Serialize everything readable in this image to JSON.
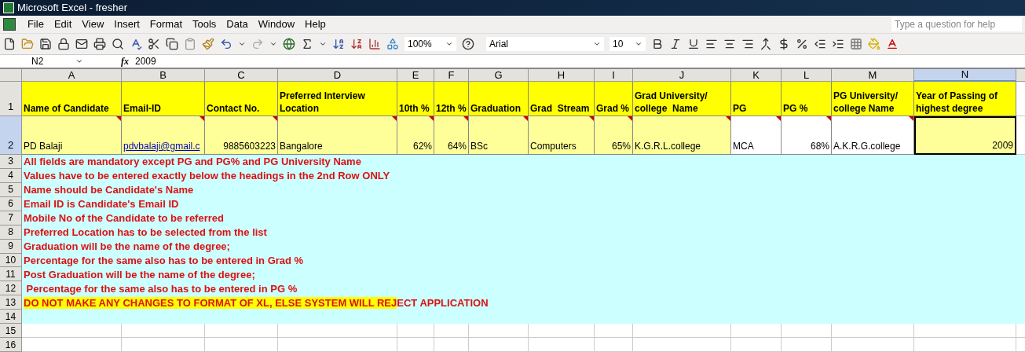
{
  "window": {
    "title": "Microsoft Excel - fresher"
  },
  "menu": [
    "File",
    "Edit",
    "View",
    "Insert",
    "Format",
    "Tools",
    "Data",
    "Window",
    "Help"
  ],
  "help_box": {
    "placeholder": "Type a question for help"
  },
  "toolbar": {
    "zoom": "100%",
    "font": "Arial",
    "font_size": "10"
  },
  "formula_bar": {
    "name_box": "N2",
    "function_label": "fx",
    "formula": "2009"
  },
  "columns": [
    {
      "letter": "A",
      "selected": false
    },
    {
      "letter": "B",
      "selected": false
    },
    {
      "letter": "C",
      "selected": false
    },
    {
      "letter": "D",
      "selected": false
    },
    {
      "letter": "E",
      "selected": false
    },
    {
      "letter": "F",
      "selected": false
    },
    {
      "letter": "G",
      "selected": false
    },
    {
      "letter": "H",
      "selected": false
    },
    {
      "letter": "I",
      "selected": false
    },
    {
      "letter": "J",
      "selected": false
    },
    {
      "letter": "K",
      "selected": false
    },
    {
      "letter": "L",
      "selected": false
    },
    {
      "letter": "M",
      "selected": false
    },
    {
      "letter": "N",
      "selected": true
    }
  ],
  "header_row": {
    "number": "1",
    "selected": false,
    "cells": [
      "Name of Candidate",
      "Email-ID",
      "Contact No.",
      "Preferred Interview Location",
      "10th %",
      "12th %",
      "Graduation",
      "Grad  Stream",
      "Grad %",
      "Grad University/ college  Name",
      "PG",
      "PG %",
      "PG University/ college Name",
      "Year of Passing of highest degree"
    ]
  },
  "data_row": {
    "number": "2",
    "selected": true,
    "cells": [
      {
        "kind": "text",
        "text": "PD Balaji",
        "highlighted": true,
        "comment": true,
        "selected": false
      },
      {
        "kind": "link",
        "text": "pdvbalaji@gmail.c",
        "highlighted": true,
        "comment": true,
        "selected": false
      },
      {
        "kind": "number",
        "text": "9885603223",
        "highlighted": true,
        "comment": true,
        "selected": false
      },
      {
        "kind": "text",
        "text": "Bangalore",
        "highlighted": true,
        "comment": true,
        "selected": false
      },
      {
        "kind": "number",
        "text": "62%",
        "highlighted": true,
        "comment": true,
        "selected": false
      },
      {
        "kind": "number",
        "text": "64%",
        "highlighted": true,
        "comment": true,
        "selected": false
      },
      {
        "kind": "text",
        "text": "BSc",
        "highlighted": true,
        "comment": true,
        "selected": false
      },
      {
        "kind": "text",
        "text": "Computers",
        "highlighted": true,
        "comment": true,
        "selected": false
      },
      {
        "kind": "number",
        "text": "65%",
        "highlighted": true,
        "comment": true,
        "selected": false
      },
      {
        "kind": "text",
        "text": "K.G.R.L.college",
        "highlighted": true,
        "comment": true,
        "selected": false
      },
      {
        "kind": "text",
        "text": "MCA",
        "highlighted": false,
        "comment": true,
        "selected": false
      },
      {
        "kind": "number",
        "text": "68%",
        "highlighted": false,
        "comment": true,
        "selected": false
      },
      {
        "kind": "text",
        "text": "A.K.R.G.college",
        "highlighted": false,
        "comment": true,
        "selected": false
      },
      {
        "kind": "number",
        "text": "2009",
        "highlighted": true,
        "comment": false,
        "selected": true
      }
    ]
  },
  "notes": [
    {
      "number": "3",
      "parts": [
        {
          "text": "All fields are mandatory except PG and PG% and PG University Name",
          "highlighted": false
        }
      ]
    },
    {
      "number": "4",
      "parts": [
        {
          "text": "Values have to be entered exactly below the headings in the 2nd Row ONLY",
          "highlighted": false
        }
      ]
    },
    {
      "number": "5",
      "parts": [
        {
          "text": "Name should be Candidate's Name",
          "highlighted": false
        }
      ]
    },
    {
      "number": "6",
      "parts": [
        {
          "text": "Email ID is Candidate's Email ID",
          "highlighted": false
        }
      ]
    },
    {
      "number": "7",
      "parts": [
        {
          "text": "Mobile No of the Candidate to be referred",
          "highlighted": false
        }
      ]
    },
    {
      "number": "8",
      "parts": [
        {
          "text": "Preferred Location has to be selected from the list",
          "highlighted": false
        }
      ]
    },
    {
      "number": "9",
      "parts": [
        {
          "text": "Graduation will be the name of the degree;",
          "highlighted": false
        }
      ]
    },
    {
      "number": "10",
      "parts": [
        {
          "text": "Percentage for the same also has to be entered in Grad %",
          "highlighted": false
        }
      ]
    },
    {
      "number": "11",
      "parts": [
        {
          "text": "Post Graduation will be the name of the degree;",
          "highlighted": false
        }
      ]
    },
    {
      "number": "12",
      "parts": [
        {
          "text": " Percentage for the same also has to be entered in PG %",
          "highlighted": false
        }
      ]
    },
    {
      "number": "13",
      "parts": [
        {
          "text": "DO NOT MAKE ANY CHANGES TO FORMAT OF XL, ELSE SYSTEM WILL REJ",
          "highlighted": true
        },
        {
          "text": "ECT APPLICATION",
          "highlighted": false
        }
      ]
    },
    {
      "number": "14"
    }
  ],
  "empty_rows": [
    "15",
    "16"
  ]
}
